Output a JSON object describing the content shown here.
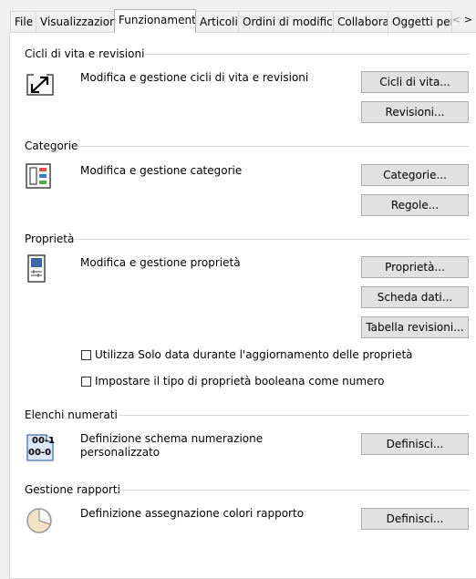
{
  "tabs": [
    {
      "label": "File",
      "active": false
    },
    {
      "label": "Visualizzazione",
      "active": false
    },
    {
      "label": "Funzionamenti",
      "active": true
    },
    {
      "label": "Articoli",
      "active": false
    },
    {
      "label": "Ordini di modifica",
      "active": false
    },
    {
      "label": "Collabora",
      "active": false
    },
    {
      "label": "Oggetti pers",
      "active": false
    }
  ],
  "tab_scroll": {
    "left": "<",
    "right": ">"
  },
  "sections": {
    "lifecycle": {
      "title": "Cicli di vita e revisioni",
      "description": "Modifica e gestione cicli di vita e revisioni",
      "buttons": [
        "Cicli di vita...",
        "Revisioni..."
      ]
    },
    "categories": {
      "title": "Categorie",
      "description": "Modifica e gestione categorie",
      "buttons": [
        "Categorie...",
        "Regole..."
      ]
    },
    "properties": {
      "title": "Proprietà",
      "description": "Modifica e gestione proprietà",
      "buttons": [
        "Proprietà...",
        "Scheda dati...",
        "Tabella revisioni..."
      ],
      "options": [
        {
          "label": "Utilizza Solo data durante l'aggiornamento delle proprietà",
          "checked": false
        },
        {
          "label": "Impostare il tipo di proprietà booleana come numero",
          "checked": false
        }
      ]
    },
    "numbering": {
      "title": "Elenchi numerati",
      "description_line1": "Definizione schema numerazione",
      "description_line2": "personalizzato",
      "button": "Definisci...",
      "icon_text_top": "00-1",
      "icon_text_bottom": "00-0"
    },
    "reports": {
      "title": "Gestione rapporti",
      "description": "Definizione assegnazione colori rapporto",
      "button": "Definisci..."
    }
  }
}
